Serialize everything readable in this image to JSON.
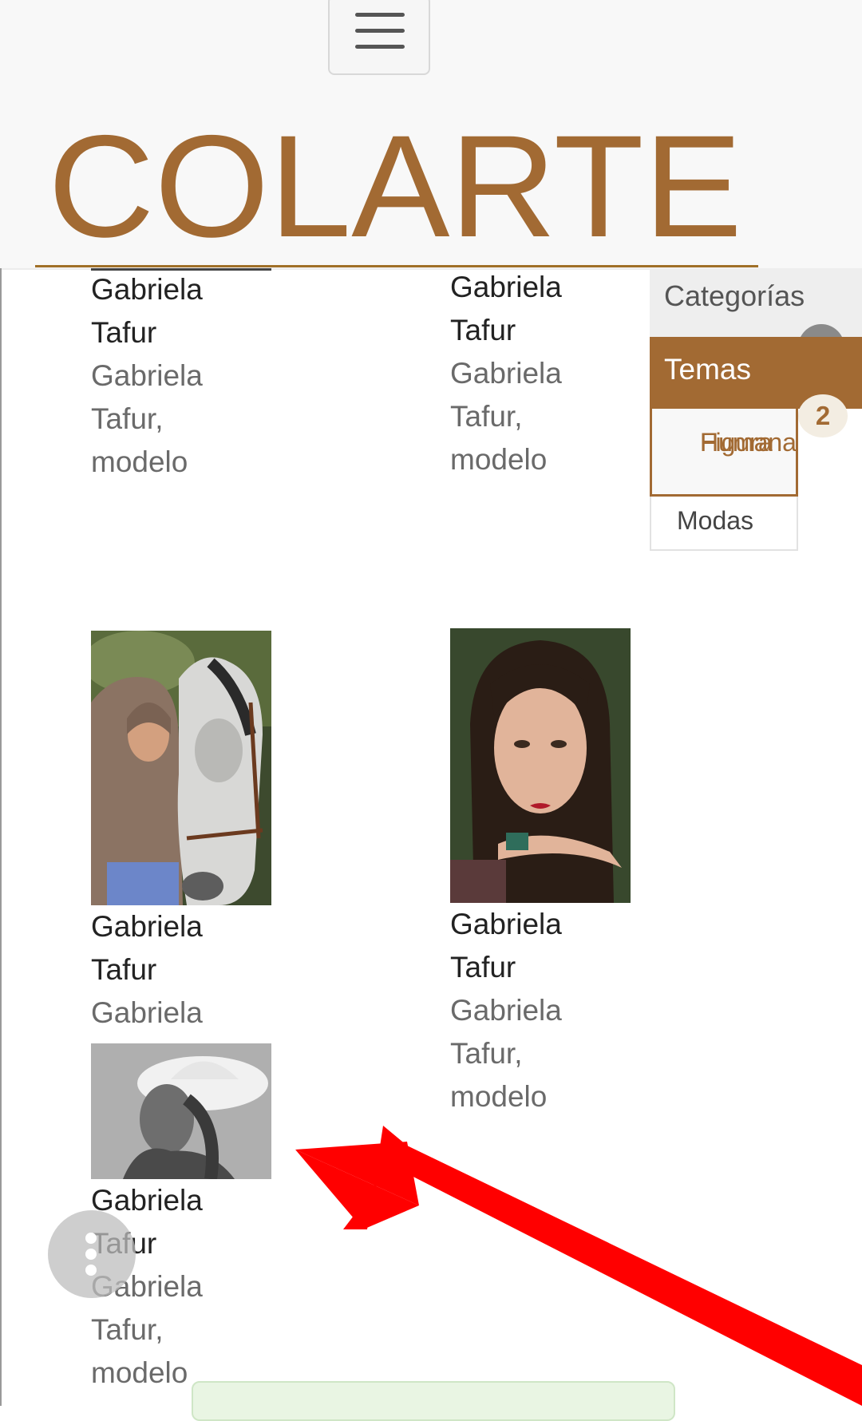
{
  "header": {
    "logo_text": "COLARTE",
    "menu_icon": "hamburger-icon",
    "brand_color": "#a26a33"
  },
  "gallery": {
    "items": [
      {
        "title_line1": "Gabriela",
        "title_line2": "Tafur",
        "caption_line1": "Gabriela",
        "caption_line2": "Tafur,",
        "caption_line3": "modelo"
      },
      {
        "title_line1": "Gabriela",
        "title_line2": "Tafur",
        "caption_line1": "Gabriela",
        "caption_line2": "Tafur,",
        "caption_line3": "modelo"
      },
      {
        "title_line1": "Gabriela",
        "title_line2": "Tafur",
        "caption_line1": "Gabriela"
      },
      {
        "title_line1": "Gabriela",
        "title_line2": "Tafur",
        "caption_line1": "Gabriela",
        "caption_line2": "Tafur,",
        "caption_line3": "modelo"
      },
      {
        "title_line1": "Gabriela",
        "title_line2": "Tafur",
        "caption_line1": "Gabriela",
        "caption_line2": "Tafur,",
        "caption_line3": "modelo"
      }
    ]
  },
  "sidebar": {
    "categorias_label": "Categorías",
    "temas_label": "Temas",
    "temas_count": "2",
    "subitems": [
      {
        "line1": "Figura",
        "line2": "Humana"
      },
      {
        "line1": "Modas"
      }
    ]
  },
  "fab": {
    "icon": "more-vertical-icon"
  },
  "annotation": {
    "icon": "red-arrow-icon",
    "color": "#ff0000"
  }
}
